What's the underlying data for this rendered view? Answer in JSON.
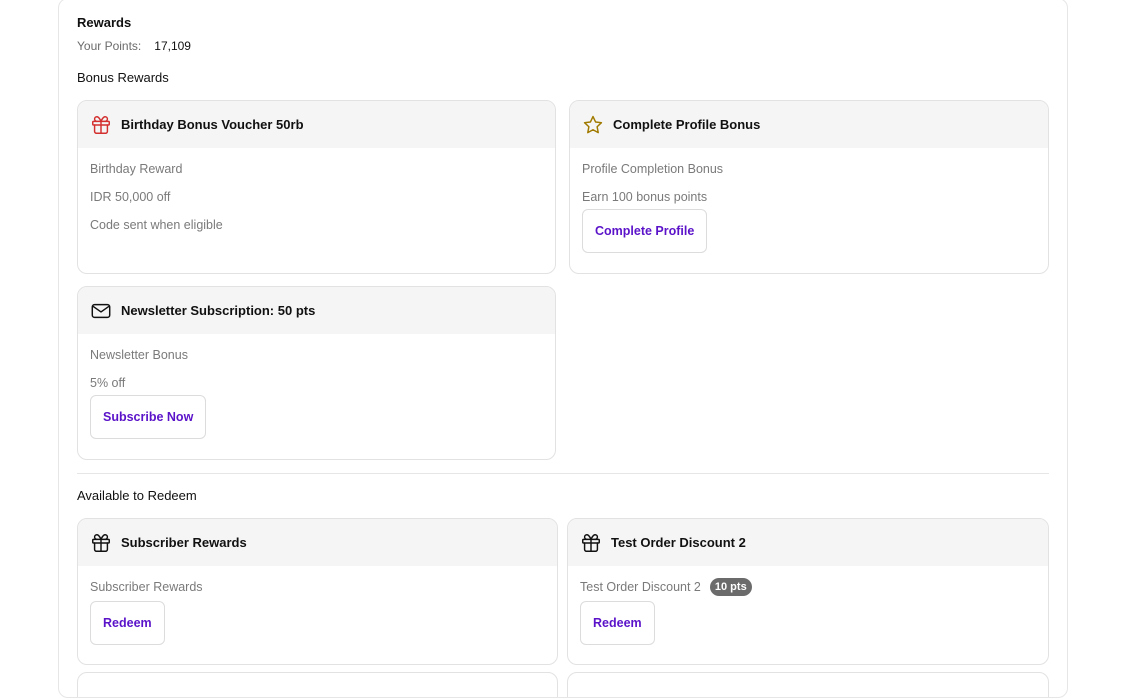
{
  "header": {
    "title": "Rewards",
    "points_label": "Your Points:",
    "points_value": "17,109"
  },
  "bonus": {
    "section_title": "Bonus Rewards",
    "cards": [
      {
        "icon": "gift-icon",
        "icon_color": "#d32f2f",
        "title": "Birthday Bonus Voucher 50rb",
        "lines": [
          "Birthday Reward",
          "IDR 50,000 off",
          "Code sent when eligible"
        ]
      },
      {
        "icon": "star-icon",
        "icon_color": "#a07a00",
        "title": "Complete Profile Bonus",
        "lines": [
          "Profile Completion Bonus",
          "Earn 100 bonus points"
        ],
        "button": "Complete Profile"
      },
      {
        "icon": "mail-icon",
        "icon_color": "#111111",
        "title": "Newsletter Subscription: 50 pts",
        "lines": [
          "Newsletter Bonus",
          "5% off"
        ],
        "button": "Subscribe Now"
      }
    ]
  },
  "redeem": {
    "section_title": "Available to Redeem",
    "cards": [
      {
        "icon": "gift-icon",
        "title": "Subscriber Rewards",
        "lines": [
          "Subscriber Rewards"
        ],
        "button": "Redeem"
      },
      {
        "icon": "gift-icon",
        "title": "Test Order Discount 2",
        "lines": [
          "Test Order Discount 2"
        ],
        "badge": "10 pts",
        "button": "Redeem"
      }
    ]
  },
  "colors": {
    "accent": "#5b13c9",
    "badge_bg": "#6b6b6b",
    "card_header_bg": "#f5f5f5"
  }
}
